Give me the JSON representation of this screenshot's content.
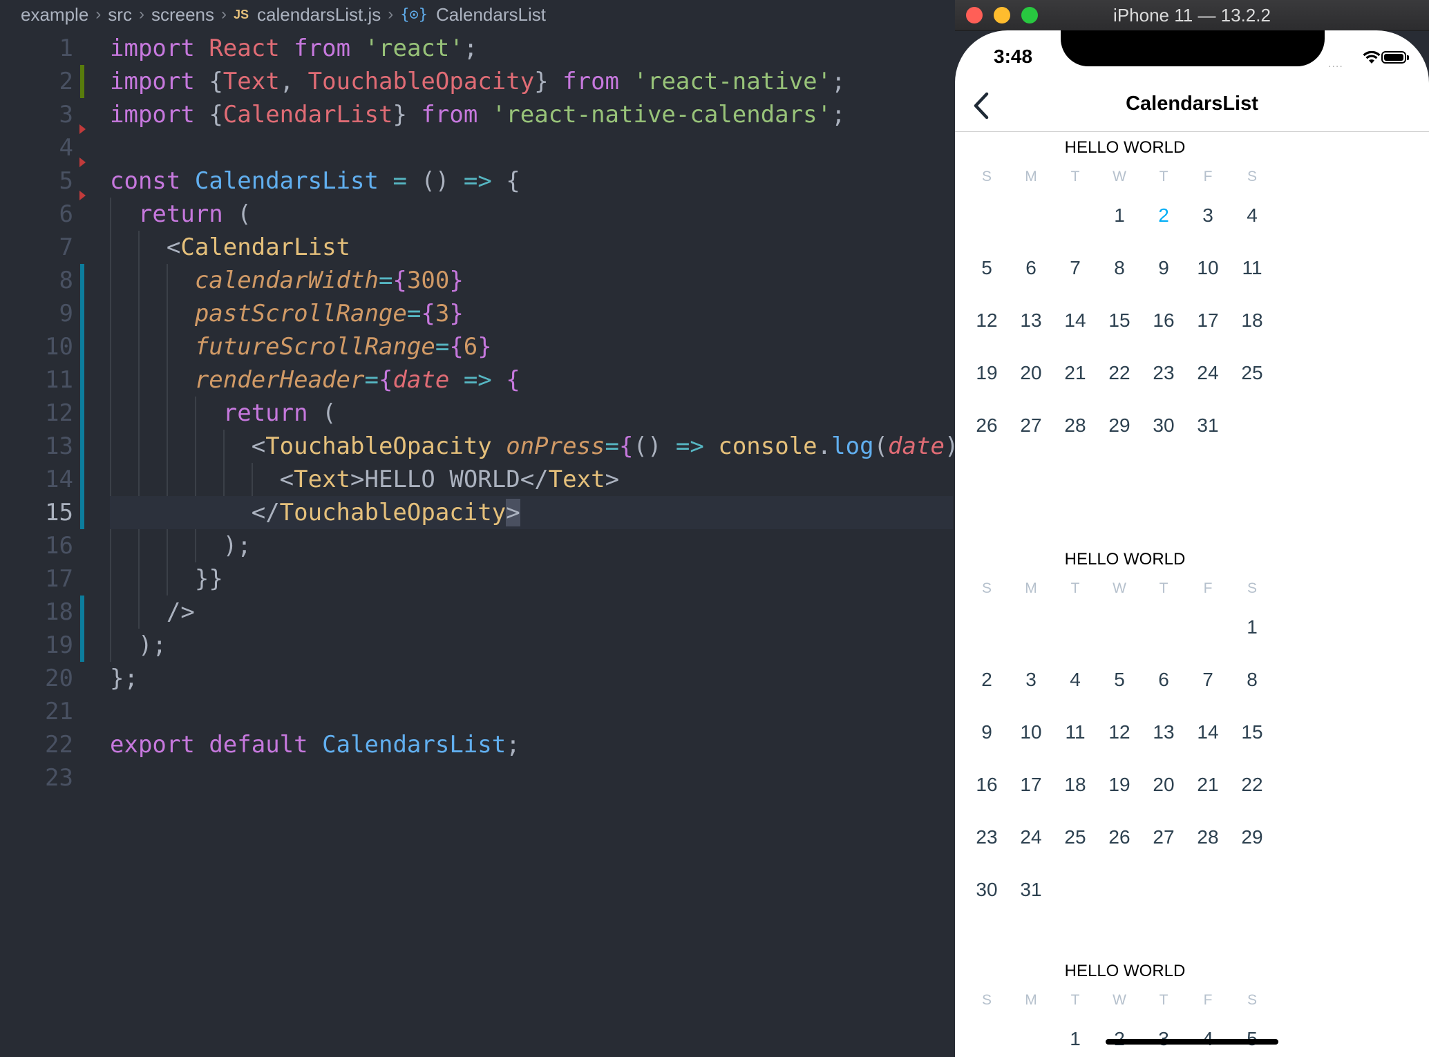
{
  "editor": {
    "breadcrumb": [
      "example",
      "src",
      "screens",
      "calendarsList.js",
      "CalendarsList"
    ],
    "breadcrumb_icons": {
      "file": "JS",
      "symbol": "{⊙}"
    },
    "code_lines": [
      "import React from 'react';",
      "import {Text, TouchableOpacity} from 'react-native';",
      "import {CalendarList} from 'react-native-calendars';",
      "",
      "const CalendarsList = () => {",
      "  return (",
      "    <CalendarList",
      "      calendarWidth={300}",
      "      pastScrollRange={3}",
      "      futureScrollRange={6}",
      "      renderHeader={date => {",
      "        return (",
      "          <TouchableOpacity onPress={() => console.log(date)}>",
      "            <Text>HELLO WORLD</Text>",
      "          </TouchableOpacity>",
      "        );",
      "      }}",
      "    />",
      "  );",
      "};",
      "",
      "export default CalendarsList;",
      ""
    ],
    "active_line": 15
  },
  "simulator": {
    "window_title": "iPhone 11 — 13.2.2",
    "status": {
      "time": "3:48",
      "signal": "....",
      "wifi_icon": "wifi-icon",
      "battery_icon": "battery-icon"
    },
    "nav": {
      "title": "CalendarsList",
      "back_icon": "chevron-left-icon"
    },
    "weekdays": [
      "S",
      "M",
      "T",
      "W",
      "T",
      "F",
      "S"
    ],
    "months": [
      {
        "header": "HELLO WORLD",
        "today": "2",
        "weeks": [
          [
            "",
            "",
            "",
            "1",
            "2",
            "3",
            "4"
          ],
          [
            "5",
            "6",
            "7",
            "8",
            "9",
            "10",
            "11"
          ],
          [
            "12",
            "13",
            "14",
            "15",
            "16",
            "17",
            "18"
          ],
          [
            "19",
            "20",
            "21",
            "22",
            "23",
            "24",
            "25"
          ],
          [
            "26",
            "27",
            "28",
            "29",
            "30",
            "31",
            ""
          ]
        ]
      },
      {
        "header": "HELLO WORLD",
        "today": "",
        "weeks": [
          [
            "",
            "",
            "",
            "",
            "",
            "",
            "1"
          ],
          [
            "2",
            "3",
            "4",
            "5",
            "6",
            "7",
            "8"
          ],
          [
            "9",
            "10",
            "11",
            "12",
            "13",
            "14",
            "15"
          ],
          [
            "16",
            "17",
            "18",
            "19",
            "20",
            "21",
            "22"
          ],
          [
            "23",
            "24",
            "25",
            "26",
            "27",
            "28",
            "29"
          ],
          [
            "30",
            "31",
            "",
            "",
            "",
            "",
            ""
          ]
        ]
      },
      {
        "header": "HELLO WORLD",
        "today": "",
        "weeks": [
          [
            "",
            "",
            "1",
            "2",
            "3",
            "4",
            "5"
          ]
        ]
      }
    ]
  }
}
